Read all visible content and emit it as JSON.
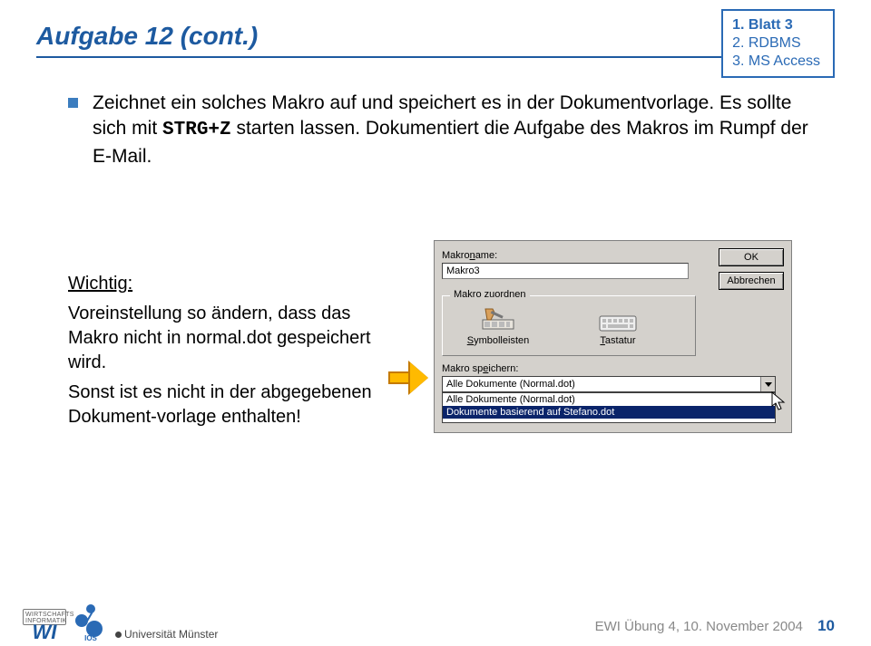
{
  "title": "Aufgabe 12 (cont.)",
  "legend": {
    "l1": "1. Blatt 3",
    "l2": "2. RDBMS",
    "l3": "3. MS Access"
  },
  "bullet": {
    "line1": "Zeichnet ein solches Makro auf und speichert es in der Dokumentvorlage. Es sollte sich mit ",
    "code": "STRG+Z",
    "line2": " starten lassen. Dokumentiert die Aufgabe des Makros im Rumpf der E-Mail."
  },
  "note": {
    "heading": "Wichtig:",
    "p1": "Voreinstellung so ändern, dass das Makro nicht in normal.dot gespeichert wird.",
    "p2": "Sonst ist es nicht in der abgegebenen Dokument-vorlage enthalten!"
  },
  "dialog": {
    "makroname_label": "Makroname:",
    "makroname_value": "Makro3",
    "ok": "OK",
    "cancel": "Abbrechen",
    "group_title": "Makro zuordnen",
    "symbolleisten": "Symbolleisten",
    "tastatur": "Tastatur",
    "speichern_label": "Makro speichern:",
    "combo_value": "Alle Dokumente (Normal.dot)",
    "list_opt1": "Alle Dokumente (Normal.dot)",
    "list_opt2": "Dokumente basierend auf Stefano.dot"
  },
  "footer": {
    "text": "EWI Übung 4, 10. November 2004",
    "page": "10"
  },
  "logos": {
    "wi_top": "WIRTSCHAFTS",
    "wi_bot": "INFORMATIK",
    "wi_big": "WI",
    "ios": "IOS",
    "uni": "Universität Münster"
  }
}
